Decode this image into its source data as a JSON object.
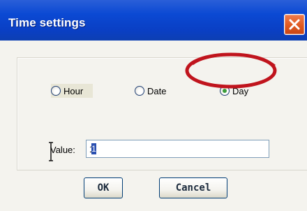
{
  "window": {
    "title": "Time settings"
  },
  "colors": {
    "titlebar_blue": "#0b49d3",
    "close_orange": "#df5a21",
    "dialog_background": "#f4f3ee",
    "highlight_red": "#c0141d",
    "radio_dot_green": "#3a9c3a"
  },
  "radios": {
    "hour": {
      "label": "Hour",
      "selected": false
    },
    "date": {
      "label": "Date",
      "selected": false
    },
    "day": {
      "label": "Day",
      "selected": true
    }
  },
  "value_field": {
    "label": "Value:",
    "value": "1"
  },
  "buttons": {
    "ok": "OK",
    "cancel": "Cancel"
  },
  "icons": {
    "close": "close-icon",
    "cursor": "i-beam-cursor-icon",
    "annotation": "red-circle-annotation"
  }
}
